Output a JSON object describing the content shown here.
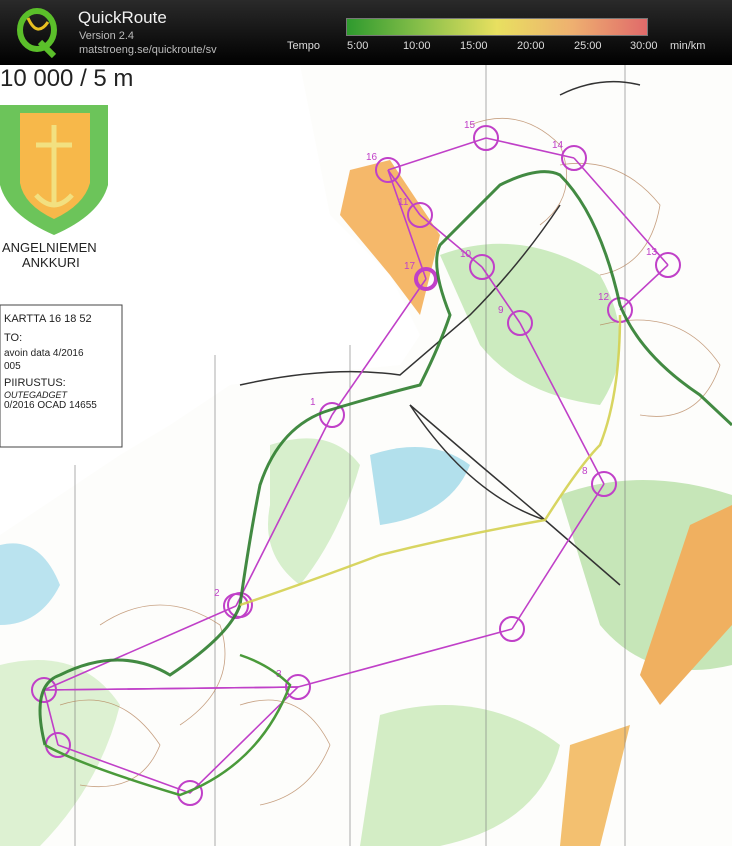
{
  "app": {
    "title": "QuickRoute",
    "version": "Version 2.4",
    "url": "matstroeng.se/quickroute/sv"
  },
  "legend": {
    "label": "Tempo",
    "ticks": [
      "5:00",
      "10:00",
      "15:00",
      "20:00",
      "25:00",
      "30:00"
    ],
    "unit": "min/km",
    "colors": [
      "#2e9a2e",
      "#8ac04a",
      "#e8e060",
      "#eeb070",
      "#e06a6a"
    ]
  },
  "map": {
    "scale_text": "10 000 / 5 m",
    "club_name_line1": "ANGELNIEMEN",
    "club_name_line2": "ANKKURI",
    "info_line1": "KARTTA  16 18 52",
    "info_line2": "TO:",
    "info_line3": "avoin data 4/2016",
    "info_line4": "005",
    "info_line5": "PIIRUSTUS:",
    "info_line6": "OUTEGADGET",
    "info_line7": "0/2016 OCAD 14655",
    "course_color": "#c040c8",
    "route_colors": [
      "#2e7d2e",
      "#d4d050"
    ],
    "controls": [
      {
        "label": "15"
      },
      {
        "label": "16"
      },
      {
        "label": "11"
      },
      {
        "label": "17"
      },
      {
        "label": "10"
      },
      {
        "label": "9"
      },
      {
        "label": "14"
      },
      {
        "label": "13"
      },
      {
        "label": "12"
      },
      {
        "label": "8"
      },
      {
        "label": "1"
      },
      {
        "label": "2"
      },
      {
        "label": "3"
      }
    ]
  }
}
